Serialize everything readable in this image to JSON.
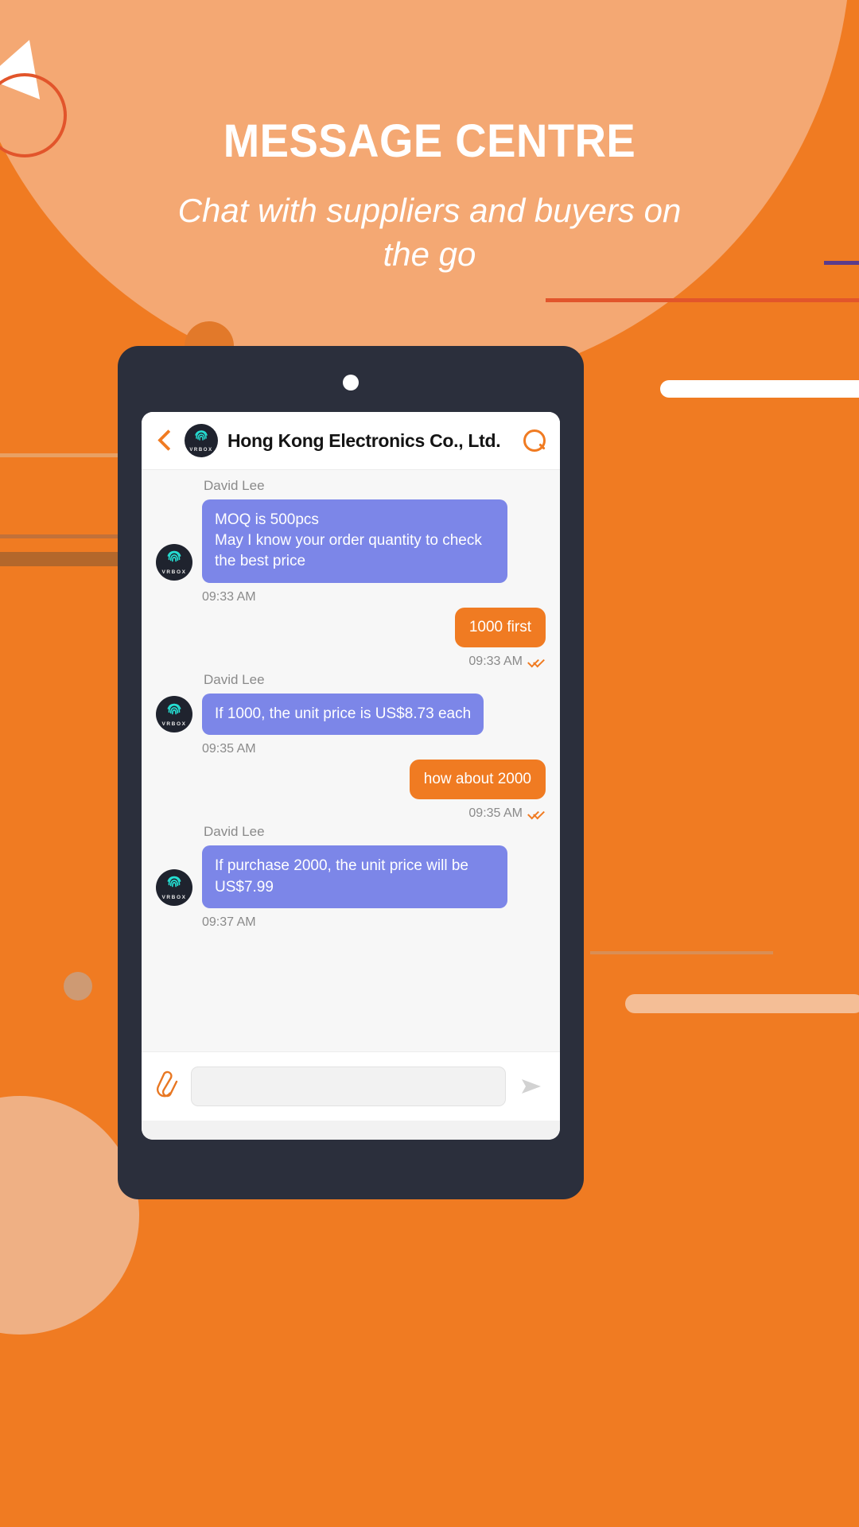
{
  "promo": {
    "title": "MESSAGE CENTRE",
    "subtitle": "Chat with suppliers and buyers on the go",
    "bg_color": "#F07B22",
    "blob_color": "#F4A873",
    "title_color": "#FFFFFF"
  },
  "phone": {
    "bezel_color": "#2B2F3C",
    "screen_bg": "#FFFFFF"
  },
  "chat": {
    "header": {
      "back_label": "",
      "title": "Hong Kong Electronics Co., Ltd.",
      "avatar_brand": "VRBOX",
      "search_label": ""
    },
    "accent_color": "#F07B22",
    "incoming_bubble_color": "#7C86E8",
    "outgoing_bubble_color": "#F07B22",
    "messages": [
      {
        "direction": "in",
        "sender": "David Lee",
        "text": "MOQ is 500pcs\nMay I know your order quantity to check the best price",
        "time": "09:33 AM",
        "status": ""
      },
      {
        "direction": "out",
        "sender": "",
        "text": "1000 first",
        "time": "09:33 AM",
        "status": "read"
      },
      {
        "direction": "in",
        "sender": "David Lee",
        "text": "If 1000, the unit price is US$8.73 each",
        "time": "09:35 AM",
        "status": ""
      },
      {
        "direction": "out",
        "sender": "",
        "text": "how about 2000",
        "time": "09:35 AM",
        "status": "read"
      },
      {
        "direction": "in",
        "sender": "David Lee",
        "text": "If purchase 2000, the unit price will be US$7.99",
        "time": "09:37 AM",
        "status": ""
      }
    ],
    "composer": {
      "attach_icon": "paperclip-icon",
      "input_value": "",
      "input_placeholder": "",
      "send_icon": "send-arrow-icon"
    }
  }
}
